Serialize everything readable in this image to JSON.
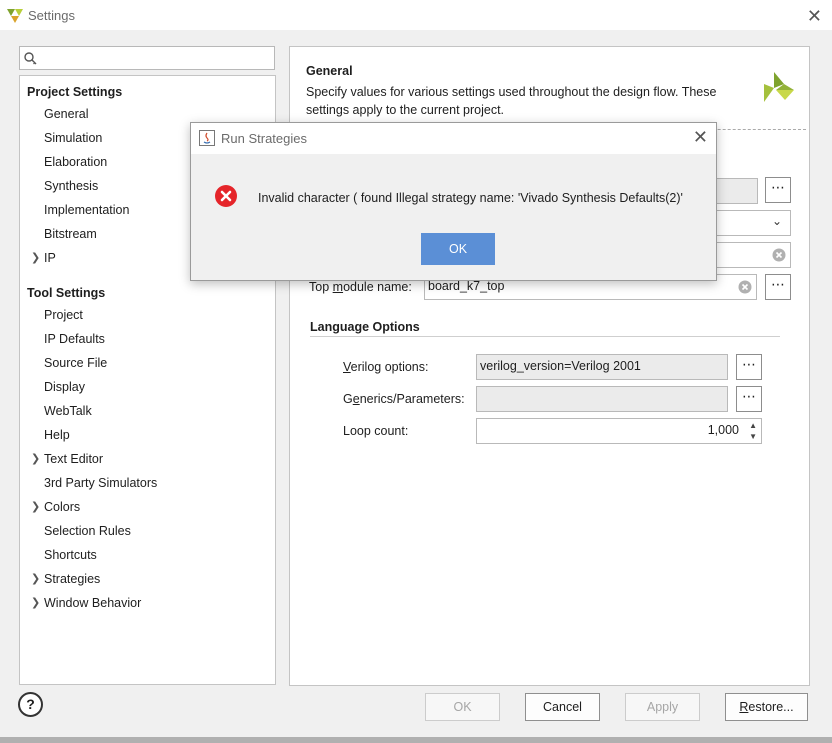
{
  "window": {
    "title": "Settings"
  },
  "search": {
    "placeholder": "",
    "value": ""
  },
  "project_settings": {
    "heading": "Project Settings",
    "items": [
      "General",
      "Simulation",
      "Elaboration",
      "Synthesis",
      "Implementation",
      "Bitstream",
      "IP"
    ]
  },
  "tool_settings": {
    "heading": "Tool Settings",
    "items": [
      "Project",
      "IP Defaults",
      "Source File",
      "Display",
      "WebTalk",
      "Help",
      "Text Editor",
      "3rd Party Simulators",
      "Colors",
      "Selection Rules",
      "Shortcuts",
      "Strategies",
      "Window Behavior"
    ]
  },
  "general": {
    "title": "General",
    "description": "Specify values for various settings used throughout the design flow. These settings apply to the current project.",
    "top_module_label_pre": "Top ",
    "top_module_label_u": "m",
    "top_module_label_post": "odule name:",
    "top_module_value": "board_k7_top"
  },
  "language_options": {
    "title": "Language Options",
    "verilog_label_u": "V",
    "verilog_label_rest": "erilog options:",
    "verilog_value": "verilog_version=Verilog 2001",
    "generics_label_pre": "G",
    "generics_label_u": "e",
    "generics_label_post": "nerics/Parameters:",
    "generics_value": "",
    "loop_label": "Loop count:",
    "loop_value": "1,000"
  },
  "buttons": {
    "ok": "OK",
    "cancel": "Cancel",
    "apply": "Apply",
    "restore_u": "R",
    "restore_rest": "estore...",
    "help": "?",
    "dots": "⋯"
  },
  "dialog": {
    "title": "Run Strategies",
    "message": "Invalid character ( found Illegal strategy name: 'Vivado Synthesis Defaults(2)'",
    "ok": "OK"
  },
  "colors": {
    "accent": "#5b8fd6",
    "error": "#e5252a",
    "brand_green": "#a5c13d"
  }
}
